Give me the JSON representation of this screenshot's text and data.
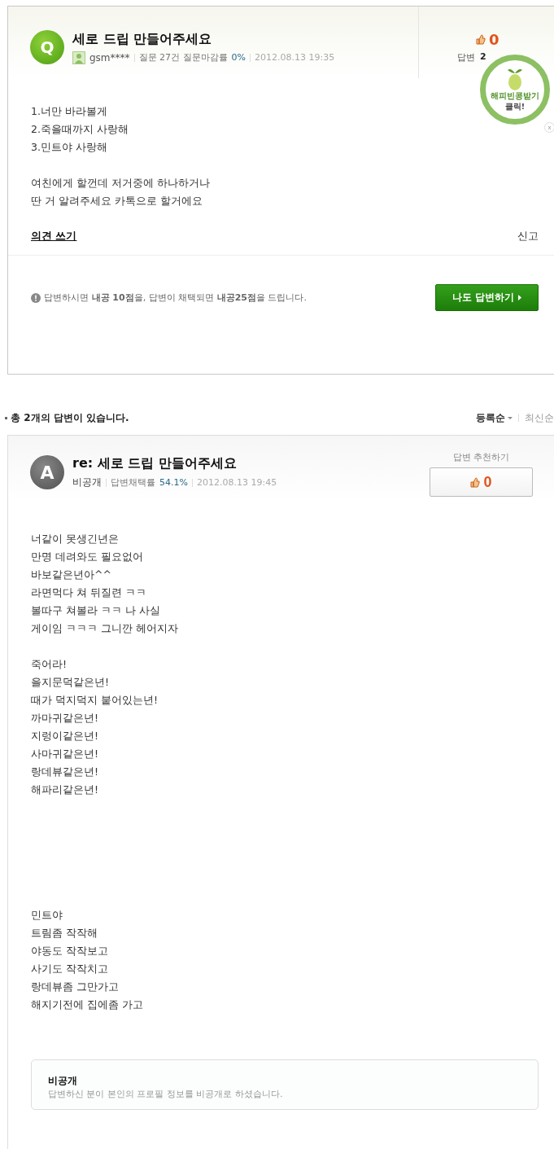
{
  "question": {
    "badge": "Q",
    "title": "세로 드립 만들어주세요",
    "author": "gsm****",
    "stats_label": "질문 27건 질문마감률",
    "rate": "0%",
    "date": "2012.08.13 19:35",
    "likes": "0",
    "answers_label": "답변",
    "answers_count": "2",
    "body": [
      [
        "1.너만 바라볼게",
        "2.죽을때까지 사랑해",
        "3.민트야 사랑해"
      ],
      [
        "여친에게 할껀데 저거중에 하나하거나",
        "딴 거 알려주세요 카톡으로 할거에요"
      ]
    ],
    "comment_link": "의견 쓰기",
    "report_link": "신고",
    "notice": "답변하시면 **내공 10점**을, 답변이 채택되면 **내공25점**을 드립니다.",
    "answer_button": "나도 답변하기"
  },
  "promo": {
    "line1": "해피빈콩받기",
    "line2": "클릭!",
    "close": "x"
  },
  "answers_header": {
    "summary": "총 **2개**의 답변이 있습니다.",
    "sorts": [
      {
        "label": "등록순",
        "selected": true
      },
      {
        "label": "최신순",
        "selected": false
      }
    ]
  },
  "answer": {
    "badge": "A",
    "title": "re: 세로 드립 만들어주세요",
    "author": "비공개",
    "stats_label": "답변채택률",
    "rate": "54.1%",
    "date": "2012.08.13 19:45",
    "recommend_label": "답변 추천하기",
    "likes": "0",
    "body": [
      [
        "너같이 못생긴년은",
        "만명 데려와도 필요없어",
        "바보같은년아^^",
        "라면먹다 쳐 뒤질련 ㅋㅋ",
        "볼따구 쳐볼라 ㅋㅋ 나 사실",
        "게이임 ㅋㅋㅋ 그니깐 헤어지자"
      ],
      [
        "죽어라!",
        "을지문덕같은년!",
        "때가 덕지덕지 붙어있는년!",
        "까마귀같은년!",
        "지렁이같은년!",
        "사마귀같은년!",
        "랑데뷰같은년!",
        "해파리같은년!"
      ],
      [
        "민트야",
        "트림좀 작작해",
        "야동도 작작보고",
        "사기도 작작치고",
        "랑데뷰좀 그만가고",
        "해지기전에 집에좀 가고"
      ]
    ],
    "profile_title": "비공개",
    "profile_note": "답변하신 분이 본인의 프로필 정보를 비공개로 하셨습니다."
  }
}
